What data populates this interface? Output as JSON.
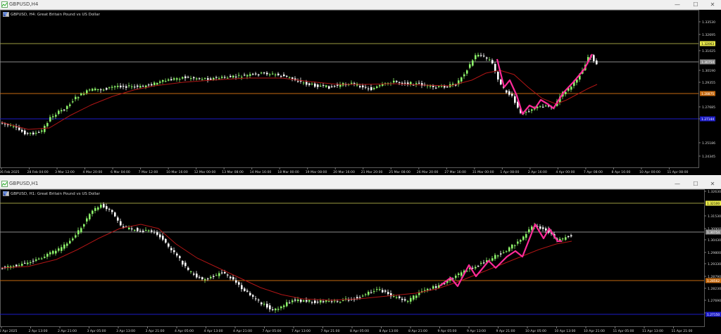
{
  "colors": {
    "bull": "#8cf26a",
    "bear": "#ffffff",
    "ma": "#b01515",
    "zigzag": "#ff2b9a",
    "level_green": "#9b9b40",
    "level_grey": "#8a8a8a",
    "level_orange": "#c66a10",
    "level_blue": "#1c1cc8",
    "axis_text": "#d6d6d6"
  },
  "top": {
    "title": "GBPUSD,H4",
    "header": "GBPUSD, H4:  Great Britain Pound vs US Dollar",
    "price_ticks": [
      "1.33530",
      "1.32695",
      "1.31025",
      "1.30190",
      "1.29355",
      "1.27685",
      "1.26850",
      "1.25186",
      "1.24345"
    ],
    "level_tags": [
      {
        "label": "1.32063",
        "kind": "green"
      },
      {
        "label": "1.30754",
        "kind": "grey"
      },
      {
        "label": "1.28875",
        "kind": "orange"
      },
      {
        "label": "1.27144",
        "kind": "blue"
      }
    ],
    "time_ticks": [
      "26 Feb 2025",
      "28 Feb 04:00",
      "3 Mar 12:00",
      "4 Mar 20:00",
      "6 Mar 04:00",
      "7 Mar 12:00",
      "10 Mar 16:00",
      "12 Mar 00:00",
      "13 Mar 08:00",
      "14 Mar 16:00",
      "18 Mar 00:00",
      "19 Mar 08:00",
      "20 Mar 16:00",
      "21 Mar 20:00",
      "25 Mar 08:00",
      "26 Mar 20:00",
      "27 Mar 16:00",
      "31 Mar 00:00",
      "1 Apr 08:00",
      "2 Apr 16:00",
      "4 Apr 00:00",
      "7 Apr 08:00",
      "8 Apr 16:00",
      "10 Apr 00:00",
      "11 Apr 08:00"
    ]
  },
  "bottom": {
    "title": "GBPUSD,H1",
    "header": "GBPUSD, H1:  Great Britain Pound vs US Dollar",
    "price_ticks": [
      "1.32630",
      "1.31530",
      "1.30900",
      "1.30430",
      "1.29800",
      "1.29330",
      "1.28790",
      "1.28230",
      "1.27690",
      "1.27150"
    ],
    "level_tags": [
      {
        "label": "1.32100",
        "kind": "green"
      },
      {
        "label": "1.30754",
        "kind": "grey"
      },
      {
        "label": "1.28562",
        "kind": "orange"
      },
      {
        "label": "1.27150",
        "kind": "blue"
      }
    ],
    "time_ticks": [
      "2 Apr 2025",
      "2 Apr 13:00",
      "2 Apr 21:00",
      "3 Apr 05:00",
      "3 Apr 13:00",
      "3 Apr 21:00",
      "4 Apr 05:00",
      "4 Apr 13:00",
      "4 Apr 21:00",
      "7 Apr 05:00",
      "7 Apr 13:00",
      "7 Apr 21:00",
      "8 Apr 05:00",
      "8 Apr 13:00",
      "8 Apr 21:00",
      "9 Apr 05:00",
      "9 Apr 13:00",
      "9 Apr 21:00",
      "10 Apr 05:00",
      "10 Apr 13:00",
      "10 Apr 21:00",
      "11 Apr 05:00",
      "11 Apr 13:00",
      "11 Apr 21:00"
    ]
  },
  "window_controls": {
    "minimize": "—",
    "maximize": "☐",
    "close": "✕"
  }
}
